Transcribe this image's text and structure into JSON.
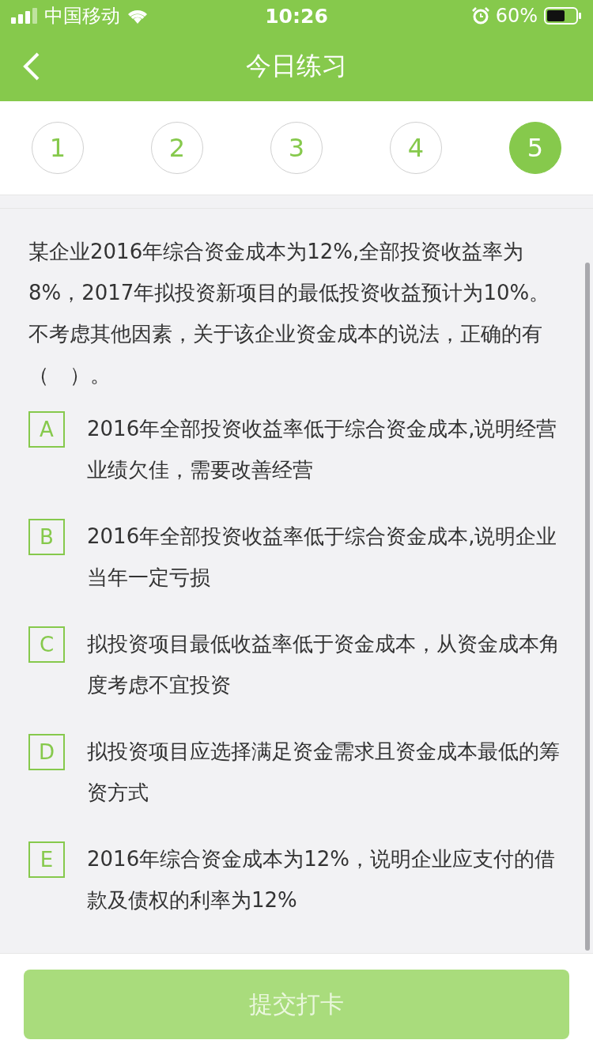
{
  "status_bar": {
    "carrier": "中国移动",
    "time": "10:26",
    "battery": "60%"
  },
  "nav": {
    "title": "今日练习"
  },
  "question_tabs": [
    {
      "label": "1",
      "selected": false
    },
    {
      "label": "2",
      "selected": false
    },
    {
      "label": "3",
      "selected": false
    },
    {
      "label": "4",
      "selected": false
    },
    {
      "label": "5",
      "selected": true
    }
  ],
  "question": {
    "text": "某企业2016年综合资金成本为12%,全部投资收益率为8%，2017年拟投资新项目的最低投资收益预计为10%。不考虑其他因素，关于该企业资金成本的说法，正确的有（　）。"
  },
  "options": [
    {
      "letter": "A",
      "text": "2016年全部投资收益率低于综合资金成本,说明经营业绩欠佳，需要改善经营"
    },
    {
      "letter": "B",
      "text": "2016年全部投资收益率低于综合资金成本,说明企业当年一定亏损"
    },
    {
      "letter": "C",
      "text": "拟投资项目最低收益率低于资金成本，从资金成本角度考虑不宜投资"
    },
    {
      "letter": "D",
      "text": "拟投资项目应选择满足资金需求且资金成本最低的筹资方式"
    },
    {
      "letter": "E",
      "text": "2016年综合资金成本为12%，说明企业应支付的借款及债权的利率为12%"
    }
  ],
  "submit": {
    "label": "提交打卡",
    "disabled": true
  }
}
